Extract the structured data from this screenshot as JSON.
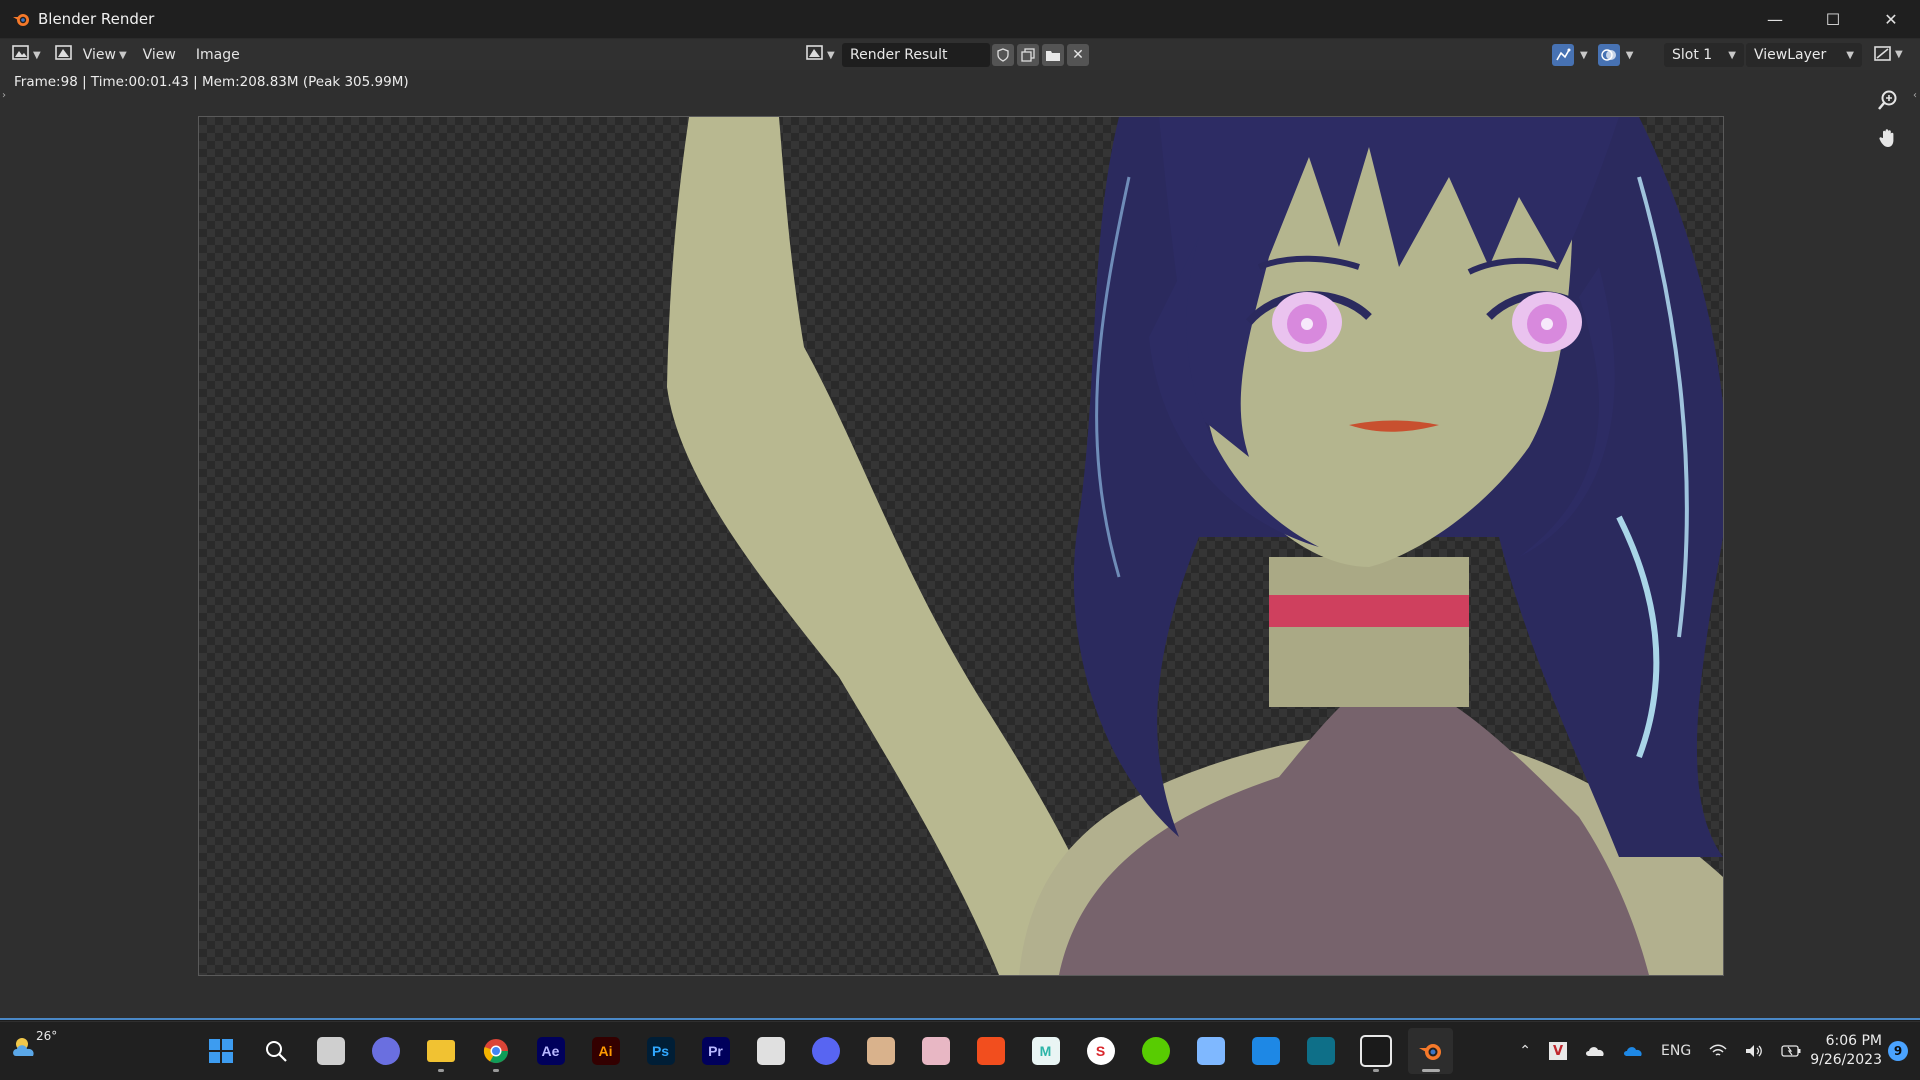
{
  "window": {
    "title": "Blender Render",
    "min_icon": "minimize-icon",
    "max_icon": "maximize-icon",
    "close_icon": "close-icon"
  },
  "header": {
    "editor_type_icon": "image-editor-icon",
    "menus": [
      "View",
      "View",
      "Image"
    ],
    "image_name": "Render Result",
    "slot": "Slot 1",
    "view_layer": "ViewLayer"
  },
  "status": {
    "text": "Frame:98 | Time:00:01.43 | Mem:208.83M (Peak 305.99M)"
  },
  "taskbar": {
    "weather_temp": "26°",
    "apps": [
      {
        "name": "Start",
        "label": "",
        "color": "#3d9cf0"
      },
      {
        "name": "Search",
        "label": "",
        "color": "#ffffff"
      },
      {
        "name": "Task View",
        "label": "",
        "color": "#cfcfcf"
      },
      {
        "name": "Meet",
        "label": "",
        "color": "#6a6fe0"
      },
      {
        "name": "File Explorer",
        "label": "",
        "color": "#f1c232"
      },
      {
        "name": "Chrome",
        "label": "",
        "color": "#4caf50"
      },
      {
        "name": "After Effects",
        "label": "Ae",
        "color": "#00005b"
      },
      {
        "name": "Illustrator",
        "label": "Ai",
        "color": "#330000"
      },
      {
        "name": "Photoshop",
        "label": "Ps",
        "color": "#001e36"
      },
      {
        "name": "Premiere",
        "label": "Pr",
        "color": "#00005b"
      },
      {
        "name": "App",
        "label": "",
        "color": "#e0e0e0"
      },
      {
        "name": "Discord",
        "label": "",
        "color": "#5865f2"
      },
      {
        "name": "App2",
        "label": "",
        "color": "#d9b28c"
      },
      {
        "name": "App3",
        "label": "",
        "color": "#e8b7c4"
      },
      {
        "name": "Figma",
        "label": "",
        "color": "#f24e1e"
      },
      {
        "name": "M App",
        "label": "M",
        "color": "#2bb5a8"
      },
      {
        "name": "S App",
        "label": "S",
        "color": "#d9262c"
      },
      {
        "name": "Duolingo",
        "label": "",
        "color": "#58cc02"
      },
      {
        "name": "App4",
        "label": "",
        "color": "#7fb8ff"
      },
      {
        "name": "VS Code",
        "label": "",
        "color": "#1e88e5"
      },
      {
        "name": "Panel App",
        "label": "",
        "color": "#0e6f88"
      },
      {
        "name": "TeamViewer",
        "label": "",
        "color": "#e8e8e8"
      },
      {
        "name": "Blender",
        "label": "",
        "color": "#f5792a"
      }
    ],
    "tray": {
      "lang": "ENG",
      "time": "6:06 PM",
      "date": "9/26/2023",
      "notifications": "9"
    }
  }
}
